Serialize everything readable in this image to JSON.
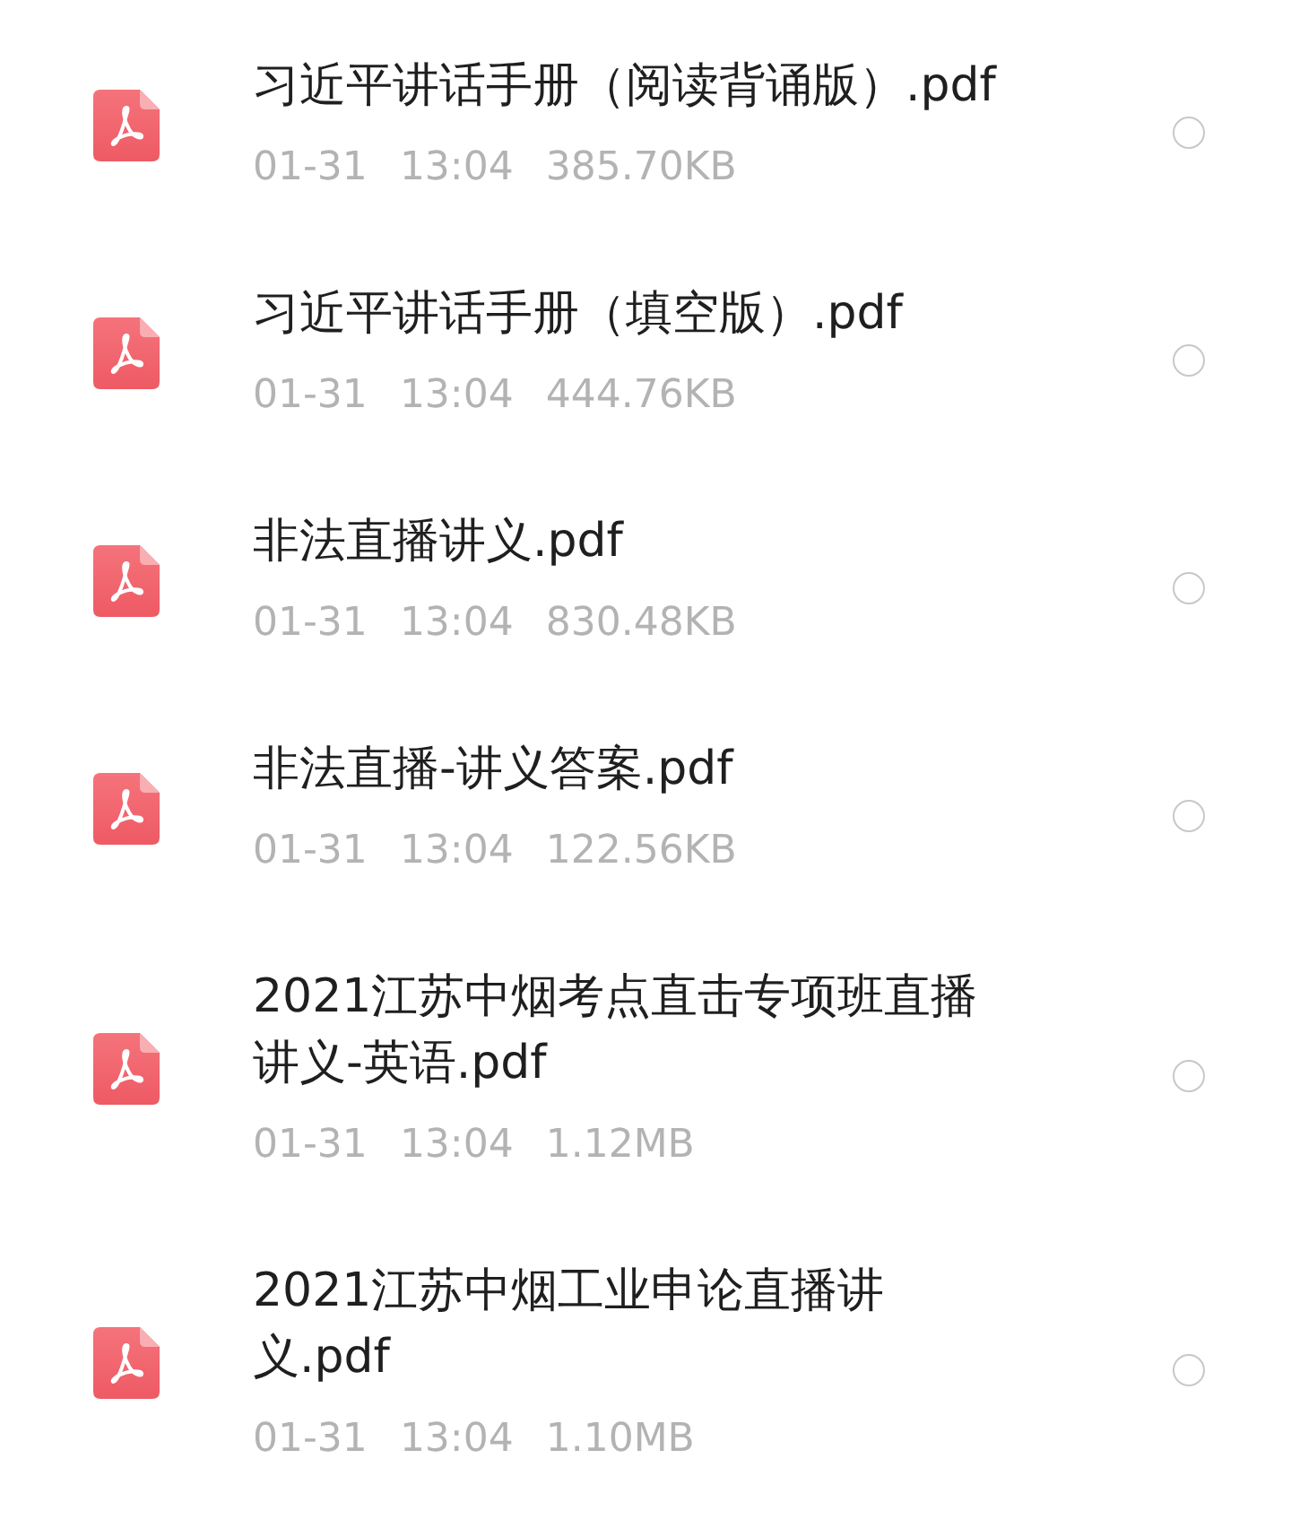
{
  "files": [
    {
      "title_lines": [
        "习近平讲话手册（阅读背诵版）.pdf"
      ],
      "date": "01-31",
      "time": "13:04",
      "size": "385.70KB",
      "selected": false
    },
    {
      "title_lines": [
        "习近平讲话手册（填空版）.pdf"
      ],
      "date": "01-31",
      "time": "13:04",
      "size": "444.76KB",
      "selected": false
    },
    {
      "title_lines": [
        "非法直播讲义.pdf"
      ],
      "date": "01-31",
      "time": "13:04",
      "size": "830.48KB",
      "selected": false
    },
    {
      "title_lines": [
        "非法直播-讲义答案.pdf"
      ],
      "date": "01-31",
      "time": "13:04",
      "size": "122.56KB",
      "selected": false
    },
    {
      "title_lines": [
        "2021江苏中烟考点直击专项班直播",
        "讲义-英语.pdf"
      ],
      "date": "01-31",
      "time": "13:04",
      "size": "1.12MB",
      "selected": false
    },
    {
      "title_lines": [
        "2021江苏中烟工业申论直播讲",
        "义.pdf"
      ],
      "date": "01-31",
      "time": "13:04",
      "size": "1.10MB",
      "selected": false
    }
  ]
}
